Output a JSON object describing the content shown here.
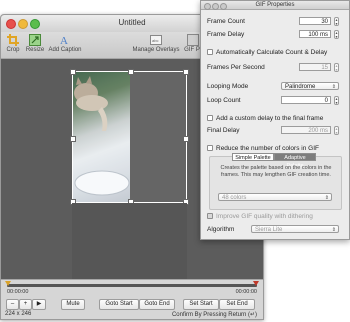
{
  "main_window": {
    "title": "Untitled",
    "toolbar": {
      "crop": "Crop",
      "resize": "Resize",
      "add_caption": "Add Caption",
      "manage_overlays": "Manage Overlays",
      "gif_properties": "GIF Pr"
    },
    "timeline": {
      "start_time": "00:00:00",
      "end_time": "00:00:00"
    },
    "controls": {
      "minus": "–",
      "plus": "+",
      "play": "▶",
      "mute": "Mute",
      "goto_start": "Goto Start",
      "goto_end": "Goto End",
      "set_start": "Set Start",
      "set_end": "Set End"
    },
    "status": {
      "dimensions": "224 x 246",
      "confirm": "Confirm By Pressing Return (↵)"
    }
  },
  "gif_properties": {
    "title": "GIF Properties",
    "frame_count_label": "Frame Count",
    "frame_count_value": "30",
    "frame_delay_label": "Frame Delay",
    "frame_delay_value": "100 ms",
    "auto_calc_label": "Automatically Calculate Count & Delay",
    "fps_label": "Frames Per Second",
    "fps_value": "15",
    "looping_mode_label": "Looping Mode",
    "looping_mode_value": "Palindrome",
    "loop_count_label": "Loop Count",
    "loop_count_value": "0",
    "custom_delay_label": "Add a custom delay to the final frame",
    "final_delay_label": "Final Delay",
    "final_delay_value": "200 ms",
    "reduce_colors_label": "Reduce the number of colors in GIF",
    "tabs": [
      "Simple Palette",
      "Adaptive Palette"
    ],
    "palette_description": "Creates the palette based on the colors in the frames.  This may lengthen GIF creation time.",
    "colors_value": "48 colors",
    "dithering_label": "Improve GIF quality with dithering",
    "algorithm_label": "Algorithm",
    "algorithm_value": "Sierra Lite"
  }
}
